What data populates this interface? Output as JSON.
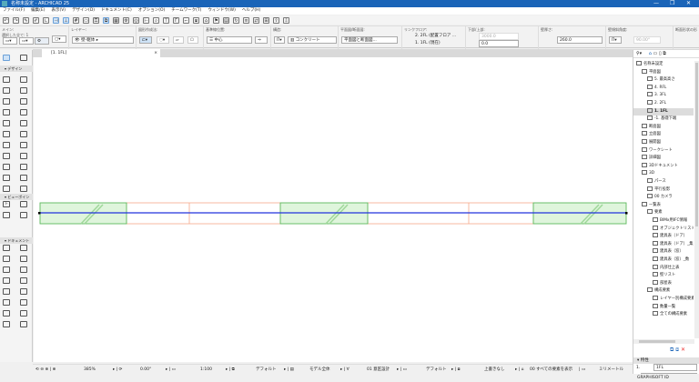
{
  "window": {
    "title": "名称未設定 - ARCHICAD 25",
    "controls": [
      "—",
      "❐",
      "✕"
    ]
  },
  "menu": [
    "ファイル(F)",
    "編集(E)",
    "表示(V)",
    "デザイン(D)",
    "ドキュメント(C)",
    "オプション(O)",
    "チームワーク(T)",
    "ウィンドウ(W)",
    "ヘルプ(H)"
  ],
  "infobox": {
    "main_label": "メイン:",
    "selected_label": "選択した全て: 1",
    "layer_label": "レイヤー:",
    "layer_value": "壁-躯体",
    "geometry_label": "図形作成法:",
    "refline_label": "基準線位置:",
    "refline_value": "中心",
    "structure_label": "構造:",
    "structure_value": "コンクリート",
    "floorplan_label": "平面図/断面図:",
    "floorplan_value": "平面図と断面図...",
    "linked_label": "リンクフロア:",
    "top_link": "2. 2FL (配置フロア ...",
    "home_story": "1. 1FL (現在)",
    "offset_label": "下部/上部:",
    "top_value": "3000.0",
    "bottom_value": "0.0",
    "thickness_label": "壁厚さ:",
    "thickness_value": "260.0",
    "slant_label": "壁傾斜角度:",
    "slant_value": "90.00°",
    "profile_label": "断面形状の形状:"
  },
  "tab": {
    "label": "[1. 1FL]"
  },
  "toolbox": {
    "sections": [
      "デザイン",
      "ビューポイント",
      "ドキュメント"
    ]
  },
  "navigator": {
    "items": [
      {
        "label": "名称未設定",
        "level": 0
      },
      {
        "label": "平面図",
        "level": 1
      },
      {
        "label": "5. 最高高さ",
        "level": 2
      },
      {
        "label": "4. RFL",
        "level": 2
      },
      {
        "label": "3. 3FL",
        "level": 2
      },
      {
        "label": "2. 2FL",
        "level": 2
      },
      {
        "label": "1. 1FL",
        "level": 2,
        "current": true
      },
      {
        "label": "-1. 基礎下端",
        "level": 2
      },
      {
        "label": "断面図",
        "level": 1
      },
      {
        "label": "立面図",
        "level": 1
      },
      {
        "label": "展開図",
        "level": 1
      },
      {
        "label": "ワークシート",
        "level": 1
      },
      {
        "label": "詳細図",
        "level": 1
      },
      {
        "label": "3Dドキュメント",
        "level": 1
      },
      {
        "label": "3D",
        "level": 1
      },
      {
        "label": "パース",
        "level": 2
      },
      {
        "label": "平行投影",
        "level": 2
      },
      {
        "label": "00 カメラ",
        "level": 2
      },
      {
        "label": "一覧表",
        "level": 1
      },
      {
        "label": "要素",
        "level": 2
      },
      {
        "label": "BIMx用IFC情報",
        "level": 3
      },
      {
        "label": "オブジェクトリスト",
        "level": 3
      },
      {
        "label": "建具表（ドア）",
        "level": 3
      },
      {
        "label": "建具表（ドア）_集",
        "level": 3
      },
      {
        "label": "建具表（窓）",
        "level": 3
      },
      {
        "label": "建具表（窓）_数",
        "level": 3
      },
      {
        "label": "内部仕上表",
        "level": 3
      },
      {
        "label": "壁リスト",
        "level": 3
      },
      {
        "label": "部屋表",
        "level": 3
      },
      {
        "label": "構成要素",
        "level": 2
      },
      {
        "label": "レイヤー別構成要素",
        "level": 3
      },
      {
        "label": "数量一覧",
        "level": 3
      },
      {
        "label": "全ての構成要素",
        "level": 3
      }
    ],
    "properties_label": "特性",
    "prop_id": "1.",
    "prop_value": "1FL",
    "settings_button": "設定...",
    "brand": "GRAPHISOFT ID"
  },
  "status": {
    "zoom": "385%",
    "angle": "0.00°",
    "scale": "1:100",
    "pen_set": "デフォルト",
    "model_view": "モデル全体",
    "layer_combo": "01 意匠設計",
    "dimension": "デフォルト",
    "override": "上書きなし",
    "renovation": "00 すべての要素を表示",
    "unit": "ミリメートル"
  },
  "colors": {
    "titlebar": "#1a64b8",
    "wall_fill": "#dff5dc",
    "wall_stroke": "#5cb85c",
    "window": "#f5a98a",
    "refline": "#2233dd"
  }
}
